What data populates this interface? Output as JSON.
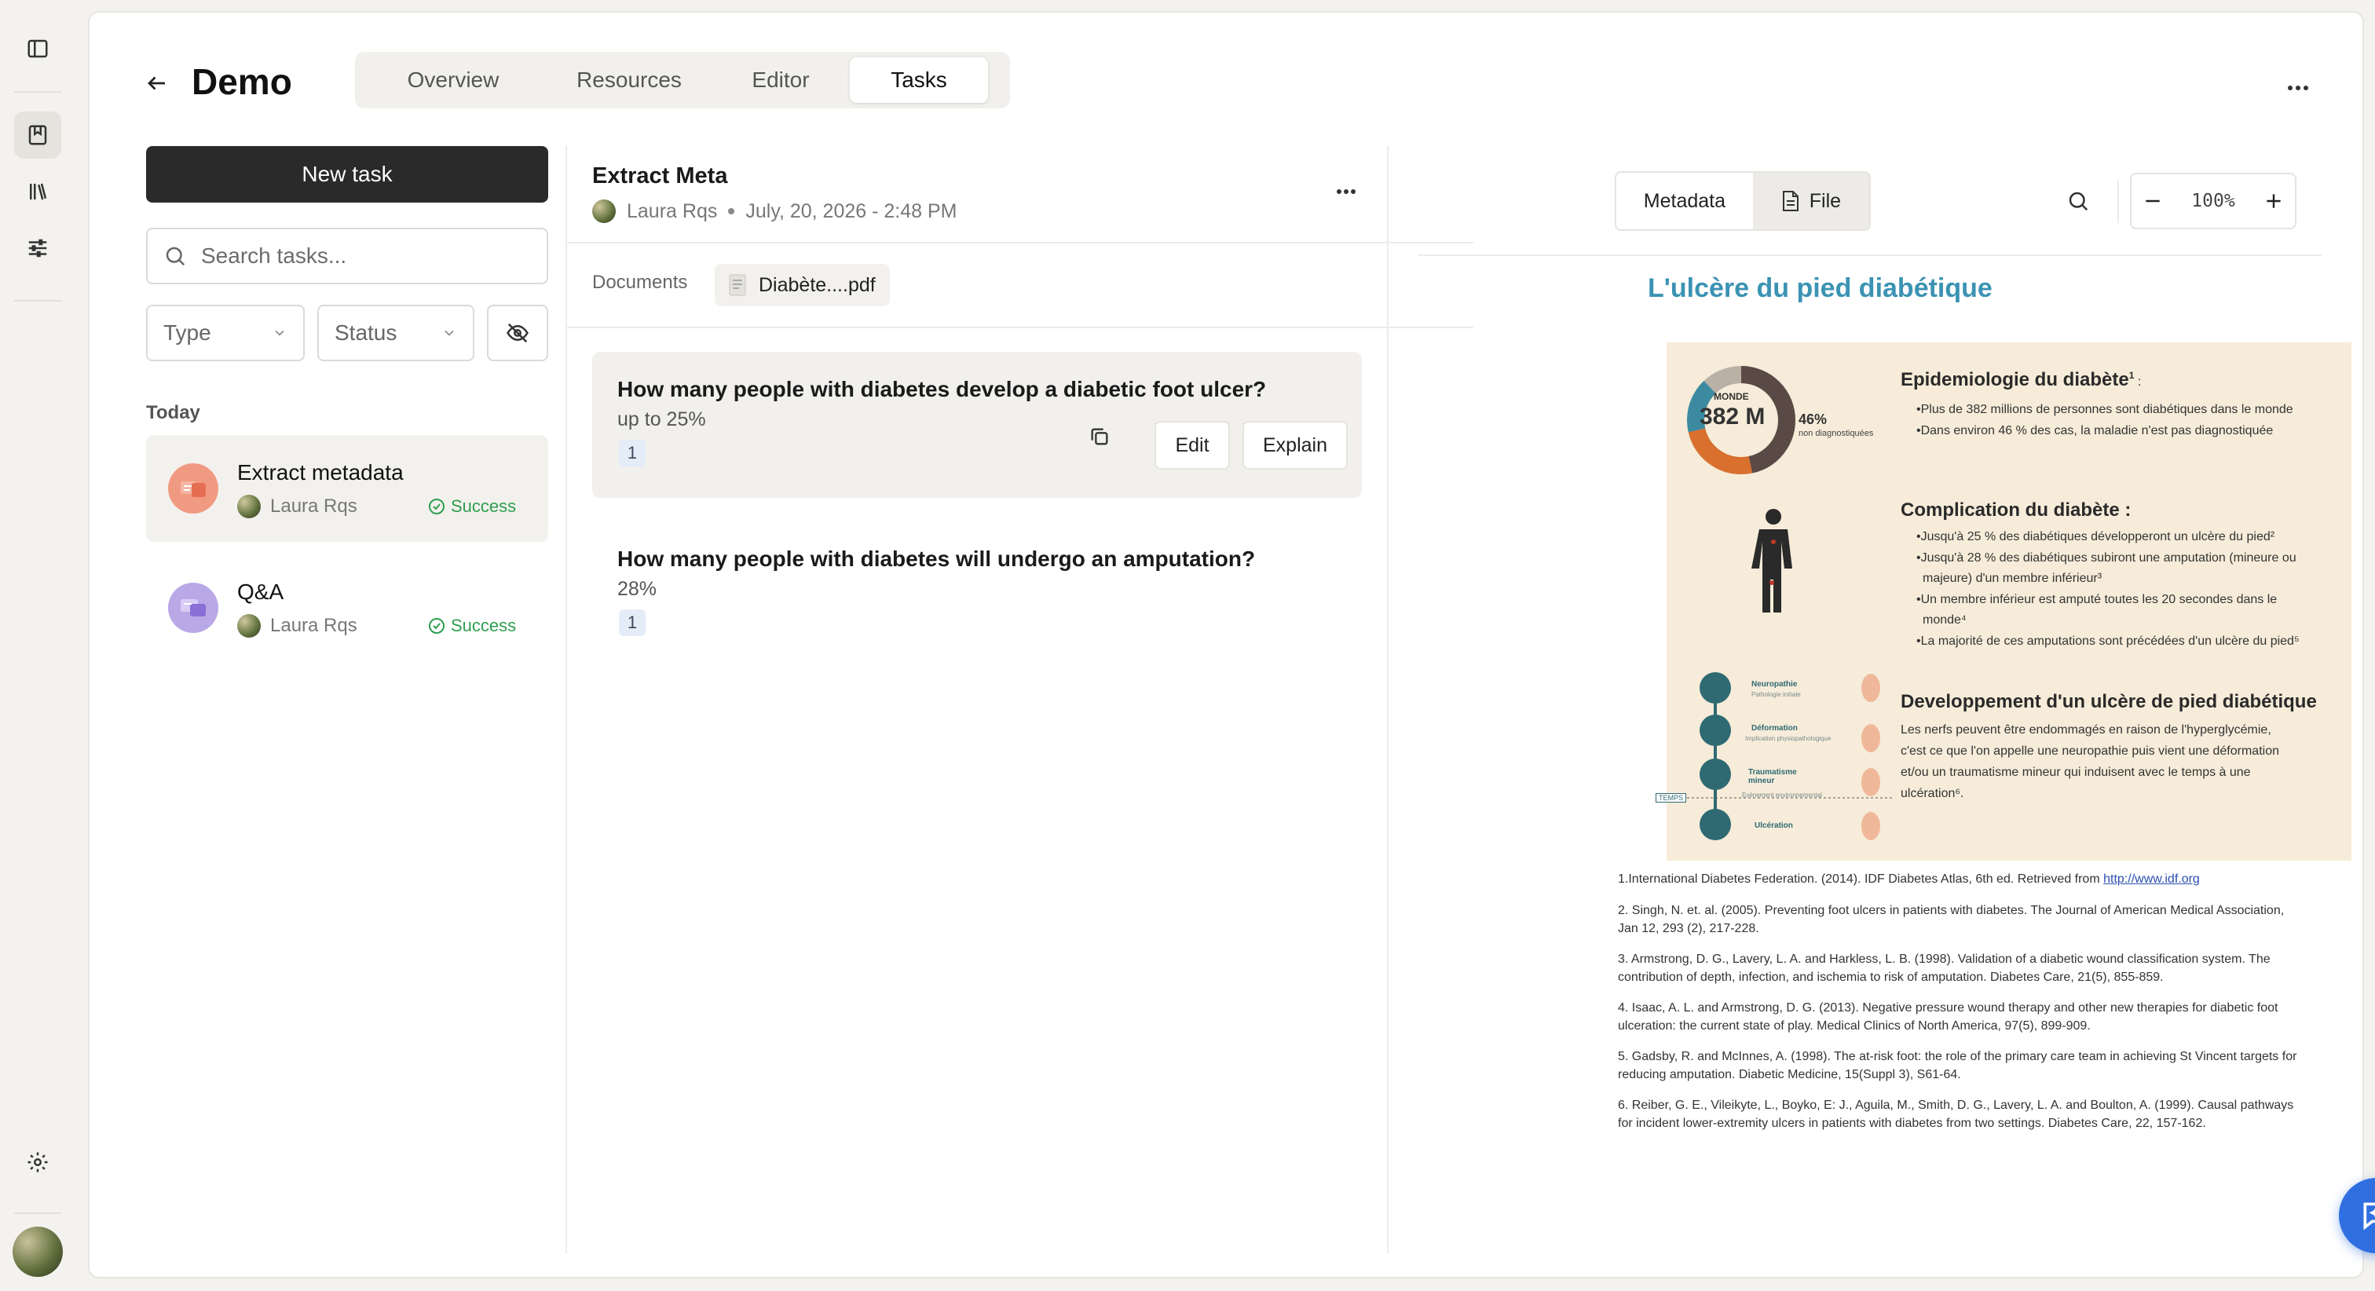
{
  "app": {
    "title": "Demo"
  },
  "tabs": [
    {
      "label": "Overview"
    },
    {
      "label": "Resources"
    },
    {
      "label": "Editor"
    },
    {
      "label": "Tasks",
      "active": true
    }
  ],
  "left": {
    "new_task_label": "New task",
    "search_placeholder": "Search tasks...",
    "filters": {
      "type_label": "Type",
      "status_label": "Status"
    },
    "group_label": "Today",
    "tasks": [
      {
        "name": "Extract metadata",
        "user": "Laura Rqs",
        "status": "Success",
        "icon": "metadata-icon",
        "active": true
      },
      {
        "name": "Q&A",
        "user": "Laura Rqs",
        "status": "Success",
        "icon": "chat-icon"
      }
    ]
  },
  "detail": {
    "title": "Extract Meta",
    "user": "Laura Rqs",
    "date": "July, 20, 2026 - 2:48 PM",
    "documents_label": "Documents",
    "document_name": "Diabète....pdf",
    "edit_label": "Edit",
    "explain_label": "Explain",
    "qas": [
      {
        "question": "How many people with diabetes develop a diabetic foot ulcer?",
        "answer": "up to 25%",
        "ref": "1"
      },
      {
        "question": "How many people with diabetes will undergo an amputation?",
        "answer": "28%",
        "ref": "1"
      }
    ]
  },
  "viewer": {
    "metadata_label": "Metadata",
    "file_label": "File",
    "zoom": "100%",
    "doc": {
      "title": "L'ulcère du pied diabétique",
      "donut": {
        "label_top": "MONDE",
        "value": "382 M",
        "percent": "46%",
        "percent_label_1": "non diagnostiquées",
        "percent_label_2": "",
        "colors": [
          "#5a4a46",
          "#d9702e",
          "#3c8aa0",
          "#b9b1a5"
        ]
      },
      "sections": [
        {
          "heading": "Epidemiologie du diabète",
          "sup": "1",
          "suffix": " :",
          "lines": [
            "•Plus de 382 millions de personnes sont diabétiques dans le monde",
            "•Dans environ 46 % des cas, la maladie n'est pas diagnostiquée"
          ]
        },
        {
          "heading": "Complication du diabète :",
          "lines": [
            "•Jusqu'à 25 % des diabétiques développeront un ulcère du pied²",
            "•Jusqu'à 28 % des diabétiques subiront une amputation (mineure ou",
            "majeure) d'un membre inférieur³",
            "•Un membre inférieur est amputé toutes les 20 secondes dans le",
            "monde⁴",
            "•La majorité de ces amputations sont précédées d'un ulcère du pied⁵"
          ]
        },
        {
          "heading": "Developpement d'un ulcère de pied diabétique",
          "lines": [
            "Les nerfs peuvent être endommagés en raison de l'hyperglycémie,",
            "c'est ce que l'on appelle une neuropathie puis vient une déformation",
            "et/ou un traumatisme mineur qui induisent avec le temps à une",
            "ulcération⁶."
          ]
        }
      ],
      "stages": [
        "Neuropathie",
        "Déformation",
        "Traumatisme mineur",
        "Ulcération"
      ],
      "stage_sub": [
        "Pathologie initiale",
        "Implication physiopathologique",
        "Evènement environnemental",
        ""
      ],
      "time_label": "TEMPS",
      "references": [
        {
          "text": "1.International Diabetes Federation. (2014). IDF Diabetes Atlas, 6th ed. Retrieved from ",
          "link": "http://www.idf.org"
        },
        {
          "text": "2. Singh, N. et. al. (2005). Preventing foot ulcers in patients with diabetes. The Journal of American Medical Association, Jan 12, 293 (2), 217-228."
        },
        {
          "text": "3. Armstrong, D. G., Lavery, L. A. and Harkless, L. B. (1998). Validation of a diabetic wound classification system. The contribution of depth, infection, and ischemia to risk of amputation. Diabetes Care, 21(5), 855-859."
        },
        {
          "text": "4. Isaac, A. L. and Armstrong, D. G. (2013). Negative pressure wound therapy and other new therapies for diabetic foot ulceration: the current state of play. Medical Clinics of North America, 97(5), 899-909."
        },
        {
          "text": "5. Gadsby, R. and McInnes, A. (1998). The at-risk foot: the role of the primary care team in achieving St Vincent targets for reducing amputation. Diabetic Medicine, 15(Suppl 3), S61-64."
        },
        {
          "text": "6. Reiber, G. E., Vileikyte, L., Boyko, E: J., Aguila, M., Smith, D. G., Lavery, L. A. and Boulton, A. (1999). Causal pathways for incident lower-extremity ulcers in patients with diabetes from two settings. Diabetes Care, 22, 157-162."
        }
      ]
    }
  },
  "colors": {
    "accent": "#2f6fe0",
    "success": "#2e9e4f",
    "dark_button": "#2a2a2a",
    "doc_title": "#3b93b3",
    "poster_bg": "#f6ecd9"
  }
}
